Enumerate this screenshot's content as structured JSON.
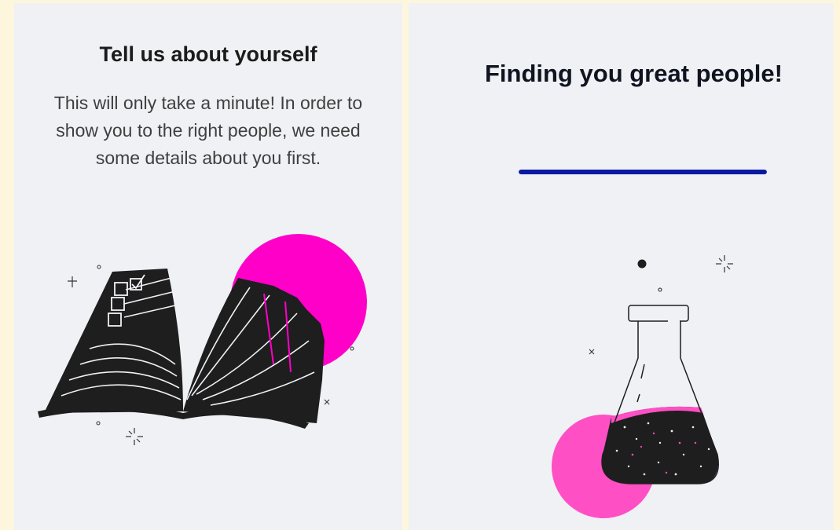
{
  "onboarding_left": {
    "title": "Tell us about yourself",
    "description": "This will only take a minute! In order to show you to the right people, we need some details about you first."
  },
  "onboarding_right": {
    "title": "Finding you great people!",
    "progress": 1.0
  },
  "colors": {
    "accent_magenta": "#ff00c8",
    "accent_pink": "#ff4fc4",
    "progress_blue": "#0a1aa0",
    "panel_bg": "#f0f1f5",
    "page_bg": "#fef6dc"
  },
  "icons": [
    "open-book-checklist-illustration",
    "lab-flask-illustration",
    "sparkle-icon"
  ]
}
